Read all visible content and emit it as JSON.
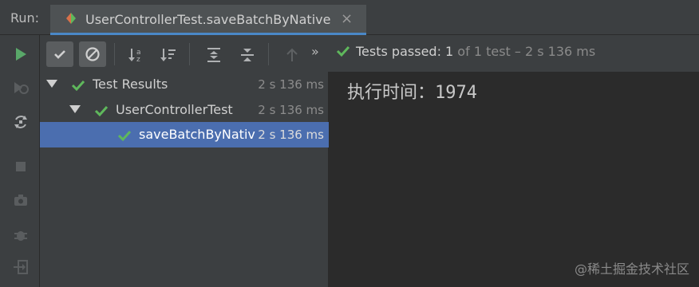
{
  "run_label": "Run:",
  "tab": {
    "title": "UserControllerTest.saveBatchByNative",
    "close": "×"
  },
  "toolbar": {
    "status_main": "Tests passed: 1",
    "status_sub": " of 1 test – 2 s 136 ms",
    "overflow": "»"
  },
  "tree": {
    "rows": [
      {
        "label": "Test Results",
        "duration": "2 s 136 ms"
      },
      {
        "label": "UserControllerTest",
        "duration": "2 s 136 ms"
      },
      {
        "label": "saveBatchByNative",
        "duration": "2 s 136 ms"
      }
    ]
  },
  "console": {
    "output": "执行时间：1974"
  },
  "watermark": "@稀土掘金技术社区",
  "colors": {
    "accent": "#4a88c7",
    "pass": "#5fb85c",
    "selection": "#4b6eaf",
    "run": "#59a869"
  }
}
